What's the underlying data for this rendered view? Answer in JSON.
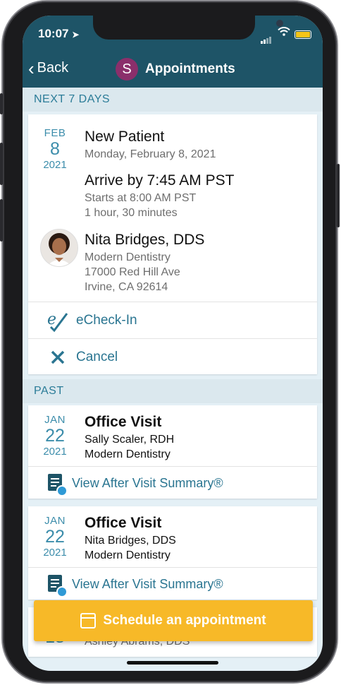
{
  "status": {
    "time": "10:07"
  },
  "nav": {
    "back_label": "Back",
    "avatar_letter": "S",
    "title": "Appointments"
  },
  "sections": {
    "upcoming": "NEXT 7 DAYS",
    "past": "PAST"
  },
  "upcoming": {
    "month": "FEB",
    "day": "8",
    "year": "2021",
    "type": "New Patient",
    "date_text": "Monday, February 8, 2021",
    "arrive": "Arrive by 7:45 AM PST",
    "starts": "Starts at 8:00 AM PST",
    "duration": "1 hour, 30 minutes",
    "provider": "Nita Bridges, DDS",
    "location": "Modern Dentistry",
    "address1": "17000 Red Hill Ave",
    "address2": "Irvine, CA 92614",
    "checkin_label": "eCheck-In",
    "cancel_label": "Cancel"
  },
  "past": [
    {
      "month": "JAN",
      "day": "22",
      "year": "2021",
      "type": "Office Visit",
      "provider": "Sally Scaler, RDH",
      "location": "Modern Dentistry",
      "link": "View After Visit Summary®"
    },
    {
      "month": "JAN",
      "day": "22",
      "year": "2021",
      "type": "Office Visit",
      "provider": "Nita Bridges, DDS",
      "location": "Modern Dentistry",
      "link": "View After Visit Summary®"
    },
    {
      "day": "18",
      "provider": "Ashley Abrams, DDS"
    }
  ],
  "schedule_label": "Schedule an appointment",
  "colors": {
    "header": "#1e5467",
    "accent": "#2b7c98",
    "button": "#f7b928",
    "avatar": "#8b2f6b"
  }
}
